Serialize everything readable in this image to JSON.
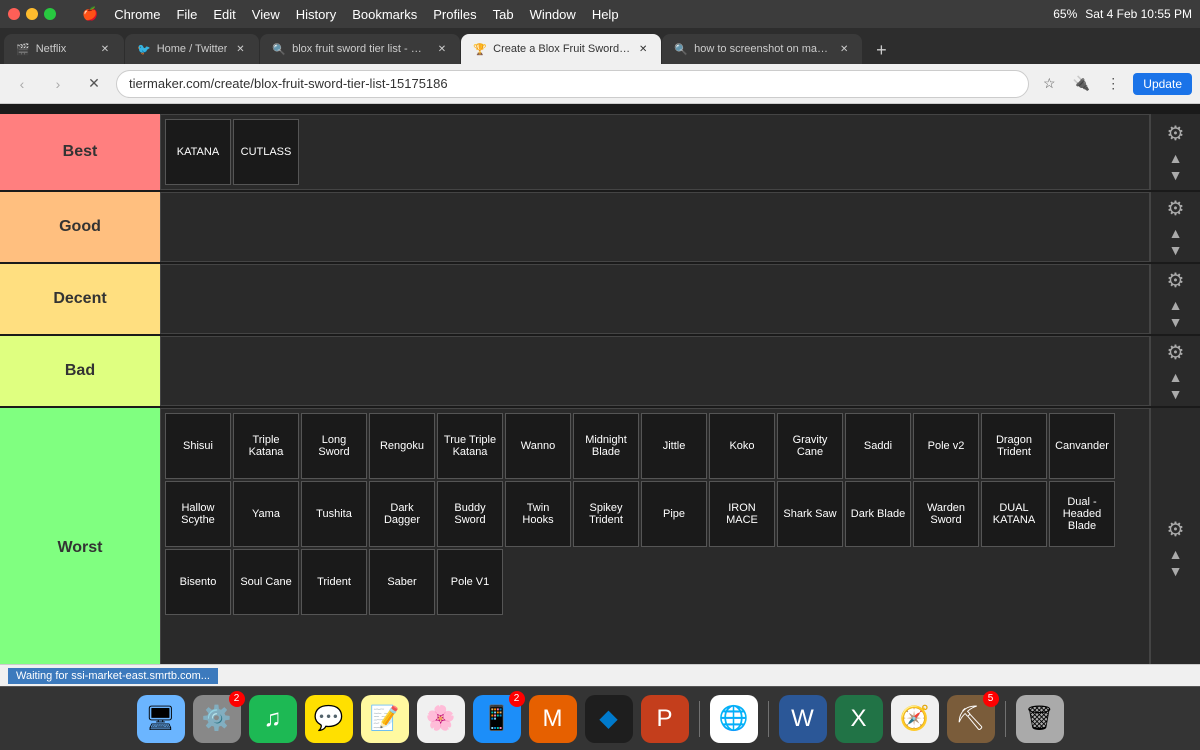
{
  "browser": {
    "time": "Sat 4 Feb  10:55 PM",
    "battery": "65%",
    "url": "tiermaker.com/create/blox-fruit-sword-tier-list-15175186",
    "update_label": "Update",
    "tabs": [
      {
        "id": "netflix",
        "label": "Netflix",
        "favicon": "🎬",
        "active": false
      },
      {
        "id": "twitter",
        "label": "Home / Twitter",
        "favicon": "🐦",
        "active": false
      },
      {
        "id": "google",
        "label": "blox fruit sword tier list - Goo...",
        "favicon": "🔍",
        "active": false
      },
      {
        "id": "tiermaker",
        "label": "Create a Blox Fruit Sword Tier...",
        "favicon": "🏆",
        "active": true
      },
      {
        "id": "screenshot",
        "label": "how to screenshot on mac - G...",
        "favicon": "🔍",
        "active": false
      }
    ],
    "nav": {
      "back": "‹",
      "forward": "›",
      "refresh": "✕"
    }
  },
  "mac_menu": [
    "🍎",
    "Chrome",
    "File",
    "Edit",
    "View",
    "History",
    "Bookmarks",
    "Profiles",
    "Tab",
    "Window",
    "Help"
  ],
  "tiers": [
    {
      "id": "best",
      "label": "Best",
      "class": "best",
      "items": [
        "KATANA",
        "CUTLASS"
      ]
    },
    {
      "id": "good",
      "label": "Good",
      "class": "good",
      "items": []
    },
    {
      "id": "decent",
      "label": "Decent",
      "class": "decent",
      "items": []
    },
    {
      "id": "bad",
      "label": "Bad",
      "class": "bad",
      "items": []
    },
    {
      "id": "worst",
      "label": "Worst",
      "class": "worst",
      "items": [
        "Shisui",
        "Triple Katana",
        "Long Sword",
        "Rengoku",
        "True Triple Katana",
        "Wanno",
        "Midnight Blade",
        "Jittle",
        "Koko",
        "Gravity Cane",
        "Saddi",
        "Pole v2",
        "Dragon Trident",
        "Canvander",
        "Hallow Scythe",
        "Yama",
        "Tushita",
        "Dark Dagger",
        "Buddy Sword",
        "Twin Hooks",
        "Spikey Trident",
        "Pipe",
        "IRON MACE",
        "Shark Saw",
        "Dark Blade",
        "Warden Sword",
        "DUAL KATANA",
        "Dual -Headed Blade",
        "Bisento",
        "Soul Cane",
        "Trident",
        "Saber",
        "Pole V1"
      ]
    }
  ],
  "status": "Waiting for ssi-market-east.smrtb.com...",
  "dock_items": [
    {
      "id": "finder",
      "emoji": "🖥",
      "badge": null
    },
    {
      "id": "settings",
      "emoji": "⚙️",
      "badge": "2"
    },
    {
      "id": "spotify",
      "emoji": "🎵",
      "badge": null
    },
    {
      "id": "kakao",
      "emoji": "💬",
      "badge": null
    },
    {
      "id": "notes",
      "emoji": "📝",
      "badge": null
    },
    {
      "id": "photos",
      "emoji": "🌸",
      "badge": null
    },
    {
      "id": "appstore",
      "emoji": "📱",
      "badge": "2"
    },
    {
      "id": "matlab",
      "emoji": "🔶",
      "badge": null
    },
    {
      "id": "vscode",
      "emoji": "💙",
      "badge": null
    },
    {
      "id": "powerpoint",
      "emoji": "🟠",
      "badge": null
    },
    {
      "id": "chrome",
      "emoji": "🌐",
      "badge": null
    },
    {
      "id": "word",
      "emoji": "🔵",
      "badge": null
    },
    {
      "id": "excel",
      "emoji": "🟢",
      "badge": null
    },
    {
      "id": "safari",
      "emoji": "🧭",
      "badge": null
    },
    {
      "id": "minecraft",
      "emoji": "🟫",
      "badge": "5"
    },
    {
      "id": "trash",
      "emoji": "🗑",
      "badge": null
    }
  ]
}
